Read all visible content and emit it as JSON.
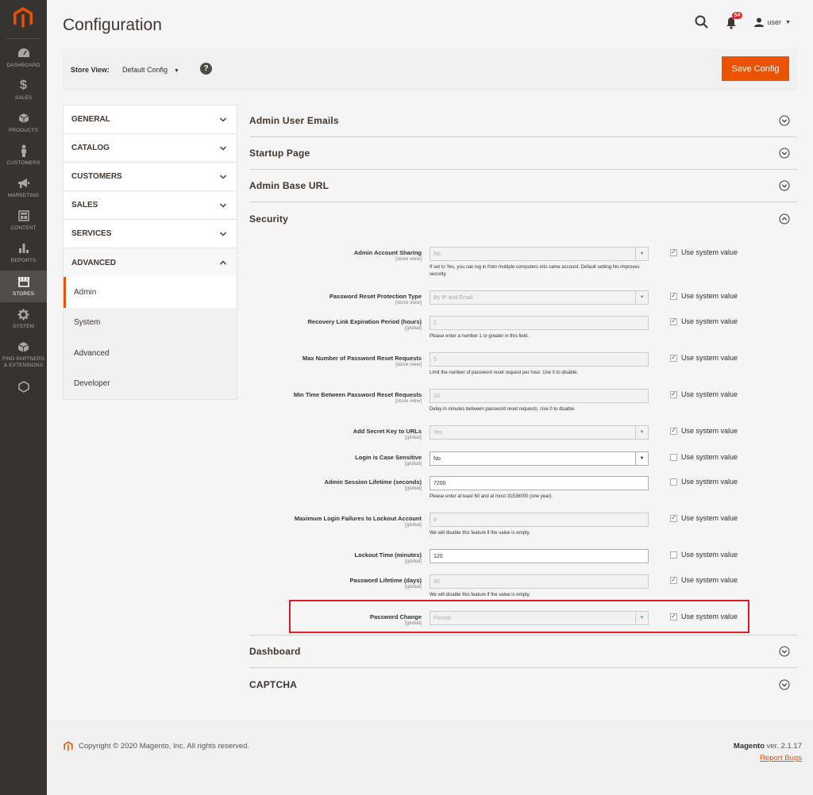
{
  "menu": {
    "items": [
      {
        "label": "DASHBOARD",
        "icon": "dashboard-icon"
      },
      {
        "label": "SALES",
        "icon": "dollar-icon"
      },
      {
        "label": "PRODUCTS",
        "icon": "box-icon"
      },
      {
        "label": "CUSTOMERS",
        "icon": "person-icon"
      },
      {
        "label": "MARKETING",
        "icon": "megaphone-icon"
      },
      {
        "label": "CONTENT",
        "icon": "layout-icon"
      },
      {
        "label": "REPORTS",
        "icon": "bar-chart-icon"
      },
      {
        "label": "STORES",
        "icon": "store-icon"
      },
      {
        "label": "SYSTEM",
        "icon": "gear-icon"
      },
      {
        "label": "FIND PARTNERS & EXTENSIONS",
        "icon": "cube-icon"
      }
    ]
  },
  "header": {
    "title": "Configuration",
    "notification_count": "54",
    "user_name": "user"
  },
  "store_bar": {
    "label": "Store View:",
    "value": "Default Config",
    "save_label": "Save Config"
  },
  "tabs": {
    "groups": [
      "GENERAL",
      "CATALOG",
      "CUSTOMERS",
      "SALES",
      "SERVICES",
      "ADVANCED"
    ],
    "subtabs": [
      "Admin",
      "System",
      "Advanced",
      "Developer"
    ]
  },
  "sections": {
    "top": [
      "Admin User Emails",
      "Startup Page",
      "Admin Base URL",
      "Security"
    ],
    "bottom": [
      "Dashboard",
      "CAPTCHA"
    ]
  },
  "security": {
    "use_system_value": "Use system value",
    "rows": [
      {
        "label": "Admin Account Sharing",
        "scope": "[store view]",
        "value": "No",
        "note": "If set to Yes, you can log in from multiple computers into same account. Default setting No improves security."
      },
      {
        "label": "Password Reset Protection Type",
        "scope": "[store view]",
        "value": "By IP and Email",
        "note": ""
      },
      {
        "label": "Recovery Link Expiration Period (hours)",
        "scope": "[global]",
        "value": "2",
        "note": "Please enter a number 1 or greater in this field."
      },
      {
        "label": "Max Number of Password Reset Requests",
        "scope": "[store view]",
        "value": "5",
        "note": "Limit the number of password reset request per hour. Use 0 to disable."
      },
      {
        "label": "Min Time Between Password Reset Requests",
        "scope": "[store view]",
        "value": "10",
        "note": "Delay in minutes between password reset requests. Use 0 to disable."
      },
      {
        "label": "Add Secret Key to URLs",
        "scope": "[global]",
        "value": "Yes",
        "note": ""
      },
      {
        "label": "Login is Case Sensitive",
        "scope": "[global]",
        "value": "No",
        "note": ""
      },
      {
        "label": "Admin Session Lifetime (seconds)",
        "scope": "[global]",
        "value": "7200",
        "note": "Please enter at least 60 and at most 31536000 (one year)."
      },
      {
        "label": "Maximum Login Failures to Lockout Account",
        "scope": "[global]",
        "value": "6",
        "note": "We will disable this feature if the value is empty."
      },
      {
        "label": "Lockout Time (minutes)",
        "scope": "[global]",
        "value": "120",
        "note": ""
      },
      {
        "label": "Password Lifetime (days)",
        "scope": "[global]",
        "value": "90",
        "note": "We will disable this feature if the value is empty."
      },
      {
        "label": "Password Change",
        "scope": "[global]",
        "value": "Forced",
        "note": ""
      }
    ]
  },
  "footer": {
    "copyright": "Copyright © 2020 Magento, Inc. All rights reserved.",
    "brand": "Magento",
    "version": " ver. 2.1.17",
    "report_bugs": "Report Bugs"
  },
  "colors": {
    "accent": "#eb5202",
    "menu_bg": "#373330",
    "highlight": "#e41a23"
  }
}
